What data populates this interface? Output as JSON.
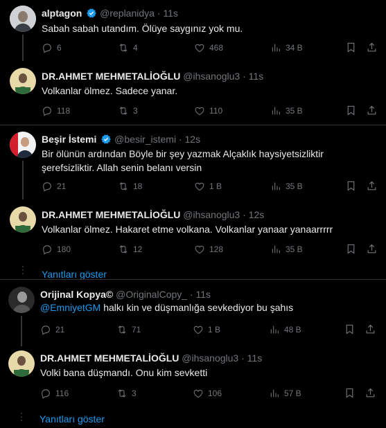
{
  "tweets": [
    {
      "name": "alptagon",
      "handle": "@replanidya",
      "time": "· 11s",
      "verified": true,
      "text": "Sabah sabah utandım. Ölüye saygınız yok mu.",
      "replies": "6",
      "reposts": "4",
      "likes": "468",
      "views": "34 B"
    },
    {
      "name": "DR.AHMET MEHMETALİOĞLU",
      "handle": "@ihsanoglu3",
      "time": "· 11s",
      "verified": false,
      "text": "Volkanlar ölmez. Sadece yanar.",
      "replies": "118",
      "reposts": "3",
      "likes": "110",
      "views": "35 B"
    },
    {
      "name": "Beşir İstemi",
      "handle": "@besir_istemi",
      "time": "· 12s",
      "verified": true,
      "text_line1": "Bir ölünün ardından Böyle bir şey yazmak Alçaklık haysiyetsizliktir",
      "text_line2": "şerefsizliktir.  Allah senin belanı versin",
      "replies": "21",
      "reposts": "18",
      "likes": "1 B",
      "views": "35 B"
    },
    {
      "name": "DR.AHMET MEHMETALİOĞLU",
      "handle": "@ihsanoglu3",
      "time": "· 12s",
      "verified": false,
      "text": "Volkanlar ölmez. Hakaret etme volkana. Volkanlar yanaar yanaarrrrr",
      "replies": "180",
      "reposts": "12",
      "likes": "128",
      "views": "35 B"
    },
    {
      "name": "Orijinal Kopya©",
      "handle": "@OriginalCopy_",
      "time": "· 11s",
      "verified": false,
      "mention": "@EmniyetGM",
      "text": " halkı kin ve düşmanlığa sevkediyor bu şahıs",
      "replies": "21",
      "reposts": "71",
      "likes": "1 B",
      "views": "48 B"
    },
    {
      "name": "DR.AHMET MEHMETALİOĞLU",
      "handle": "@ihsanoglu3",
      "time": "· 11s",
      "verified": false,
      "text": "Volki bana düşmandı. Onu kim sevketti",
      "replies": "116",
      "reposts": "3",
      "likes": "106",
      "views": "57 B"
    }
  ],
  "show_replies_label": "Yanıtları göster",
  "colors": {
    "accent": "#1d9bf0",
    "muted": "#71767b",
    "text": "#e7e9ea",
    "bg": "#000000"
  }
}
